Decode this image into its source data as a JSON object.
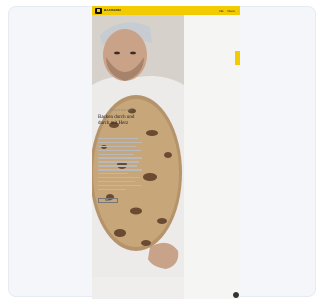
{
  "page": {
    "brand": "BÄCKEREI",
    "nav": [
      "DE",
      "Menü"
    ],
    "kicker": "HANDWERK",
    "headline": "Backen durch und durch mit Herz",
    "cta": "Mehr"
  },
  "colors": {
    "accent": "#f2cb00",
    "background": "#f4f6fa"
  }
}
